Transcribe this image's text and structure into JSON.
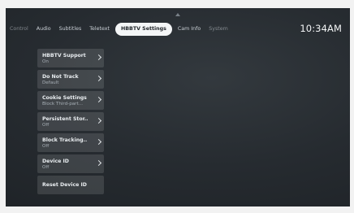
{
  "tabs": [
    {
      "label": "Control",
      "active": false
    },
    {
      "label": "Audio",
      "active": false
    },
    {
      "label": "Subtitles",
      "active": false
    },
    {
      "label": "Teletext",
      "active": false
    },
    {
      "label": "HBBTV Settings",
      "active": true
    },
    {
      "label": "Cam Info",
      "active": false
    },
    {
      "label": "System",
      "active": false
    }
  ],
  "clock": "10:34AM",
  "menu": [
    {
      "title": "HBBTV Support",
      "value": "On"
    },
    {
      "title": "Do Not Track",
      "value": "Default"
    },
    {
      "title": "Cookie Settings",
      "value": "Block Third-part..."
    },
    {
      "title": "Persistent Stor..",
      "value": "Off"
    },
    {
      "title": "Block Tracking..",
      "value": "Off"
    },
    {
      "title": "Device ID",
      "value": "Off"
    },
    {
      "title": "Reset Device ID",
      "value": ""
    }
  ]
}
